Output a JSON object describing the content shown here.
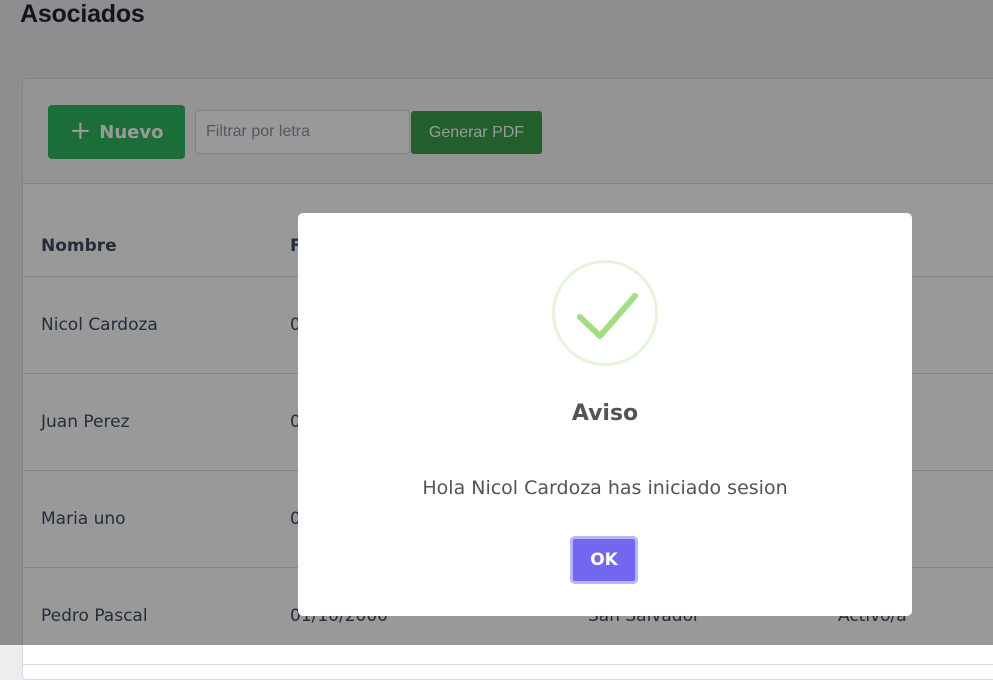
{
  "page": {
    "title": "Asociados"
  },
  "toolbar": {
    "new_label": "Nuevo",
    "filter_placeholder": "Filtrar por letra",
    "pdf_label": "Generar PDF"
  },
  "table": {
    "headers": [
      "Nombre",
      "F",
      "",
      ""
    ],
    "rows": [
      [
        "Nicol Cardoza",
        "0",
        "",
        ""
      ],
      [
        "Juan Perez",
        "0",
        "",
        ""
      ],
      [
        "Maria uno",
        "0",
        "",
        ""
      ],
      [
        "Pedro Pascal",
        "01/10/2000",
        "San Salvador",
        "Activo/a"
      ]
    ]
  },
  "dialog": {
    "icon": "success-check-icon",
    "title": "Aviso",
    "message": "Hola Nicol Cardoza has iniciado sesion",
    "ok_label": "OK"
  },
  "colors": {
    "success": "#2eb85c",
    "pdf_button": "#3b9e4a",
    "ok_button": "#7367f0",
    "check": "#a5dc86"
  }
}
